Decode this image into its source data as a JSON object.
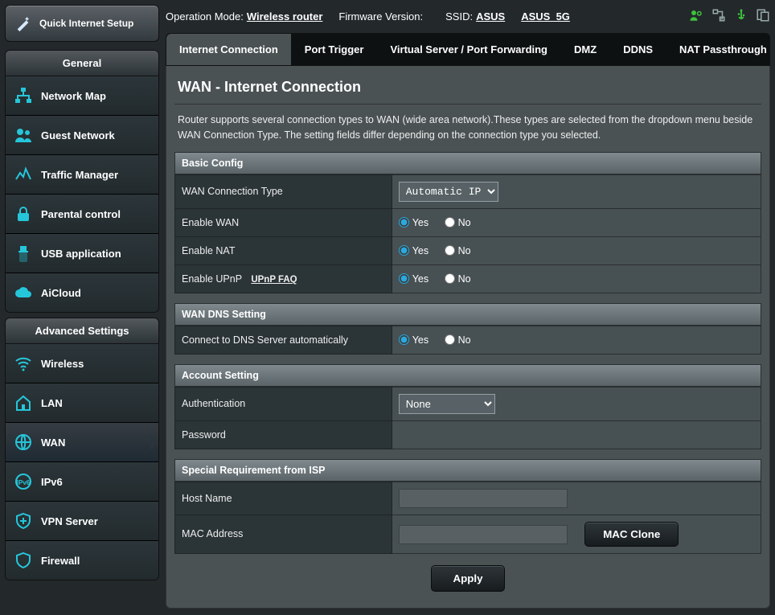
{
  "header": {
    "op_mode_lbl": "Operation Mode:",
    "op_mode": "Wireless router",
    "fw_lbl": "Firmware Version:",
    "ssid_lbl": "SSID:",
    "ssid1": "ASUS",
    "ssid2": "ASUS_5G"
  },
  "qis": "Quick Internet Setup",
  "menu": {
    "general": "General",
    "g": [
      "Network Map",
      "Guest Network",
      "Traffic Manager",
      "Parental control",
      "USB application",
      "AiCloud"
    ],
    "advanced": "Advanced Settings",
    "a": [
      "Wireless",
      "LAN",
      "WAN",
      "IPv6",
      "VPN Server",
      "Firewall"
    ]
  },
  "tabs": [
    "Internet Connection",
    "Port Trigger",
    "Virtual Server / Port Forwarding",
    "DMZ",
    "DDNS",
    "NAT Passthrough"
  ],
  "page": {
    "title": "WAN - Internet Connection",
    "desc": "Router supports several connection types to WAN (wide area network).These types are selected from the dropdown menu beside WAN Connection Type. The setting fields differ depending on the connection type you selected.",
    "yes": "Yes",
    "no": "No",
    "basic": {
      "hdr": "Basic Config",
      "wan_type_lbl": "WAN Connection Type",
      "wan_type": "Automatic IP",
      "enable_wan": "Enable WAN",
      "enable_nat": "Enable NAT",
      "enable_upnp": "Enable UPnP",
      "upnp_faq": "UPnP FAQ"
    },
    "dns": {
      "hdr": "WAN DNS Setting",
      "auto": "Connect to DNS Server automatically"
    },
    "acct": {
      "hdr": "Account Setting",
      "auth_lbl": "Authentication",
      "auth": "None",
      "pwd": "Password"
    },
    "isp": {
      "hdr": "Special Requirement from ISP",
      "host": "Host Name",
      "mac": "MAC Address",
      "clone": "MAC Clone"
    },
    "apply": "Apply"
  }
}
